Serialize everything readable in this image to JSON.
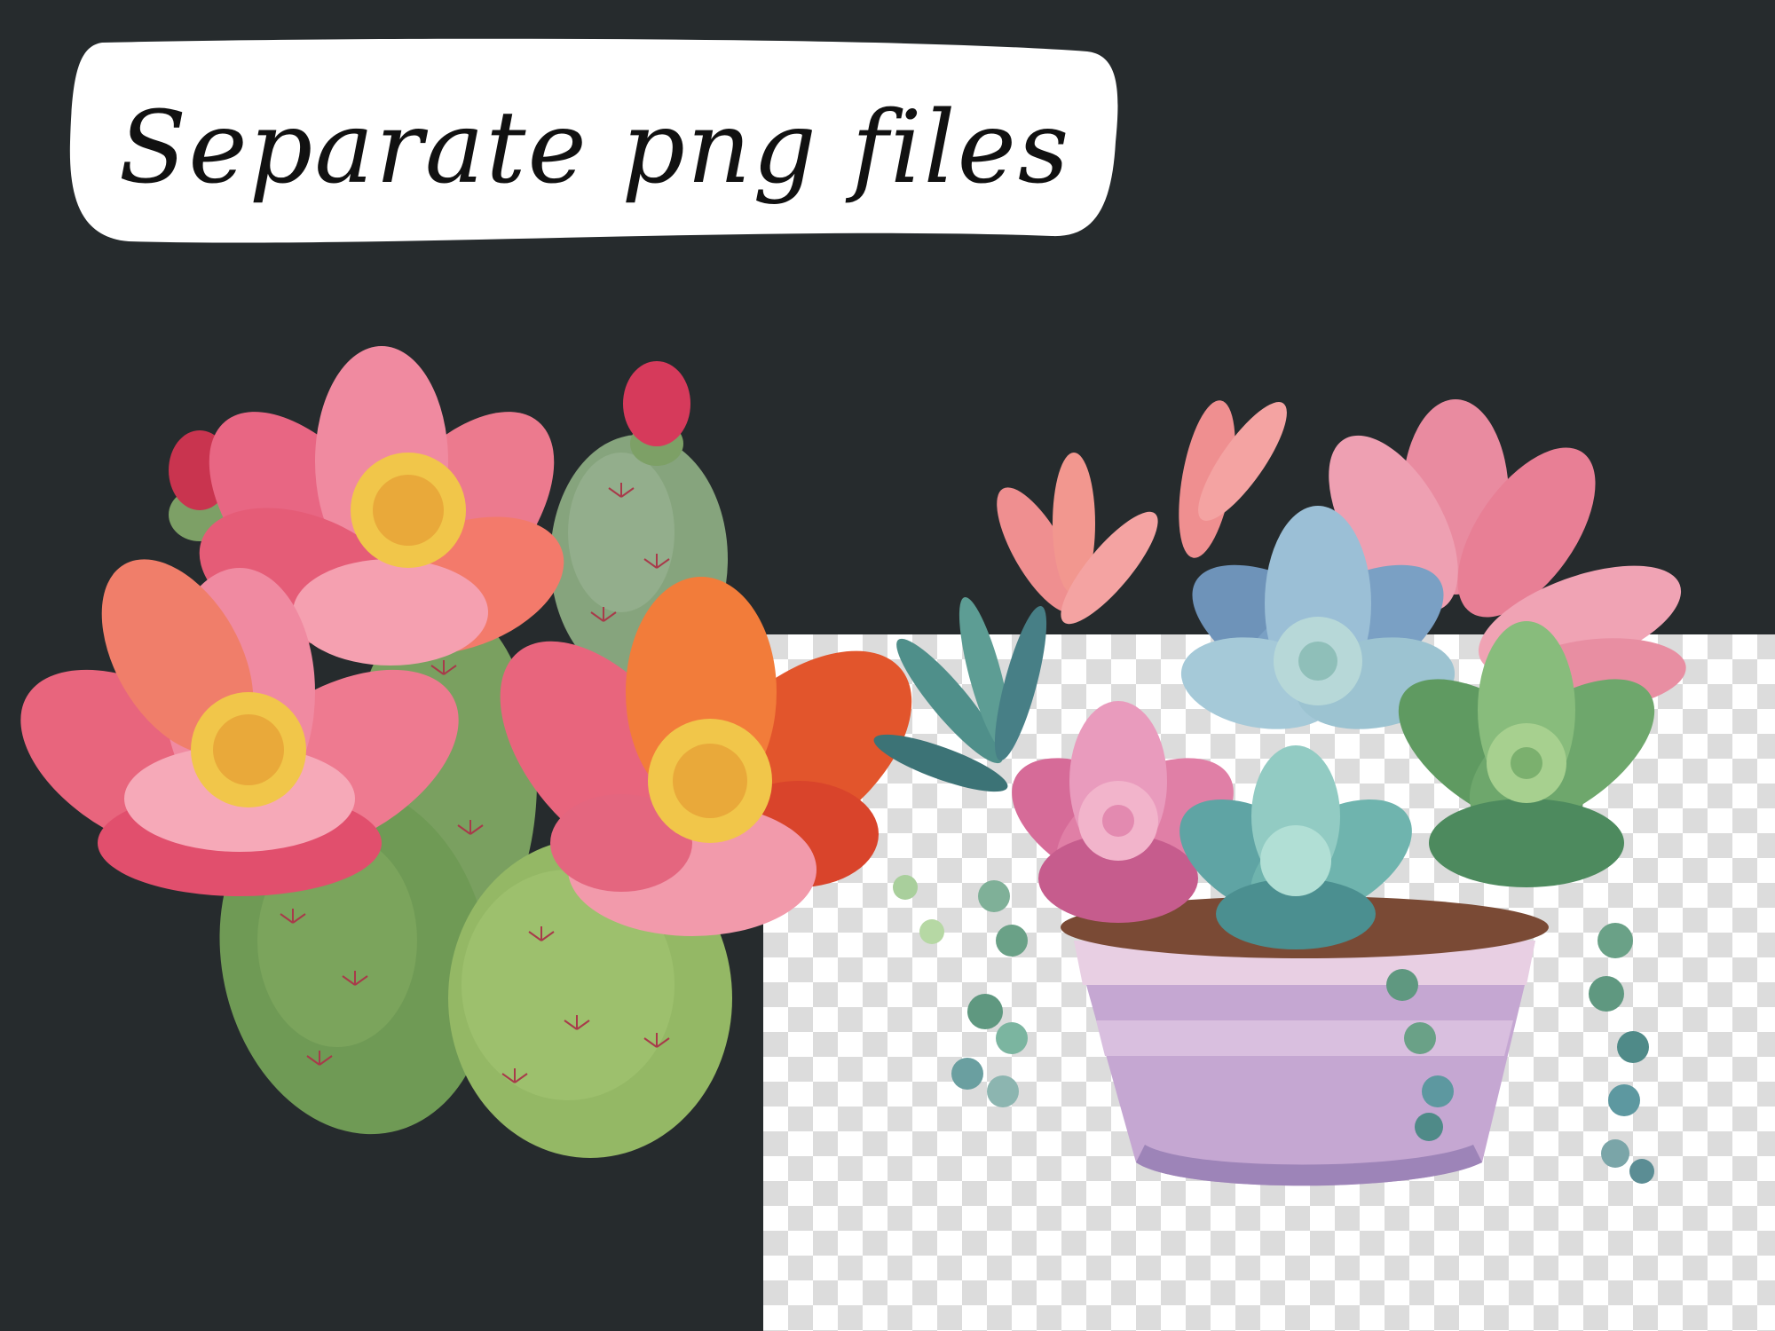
{
  "banner": {
    "text": "Separate png files"
  },
  "images": {
    "cactus": "watercolor-prickly-pear-cactus",
    "succulent": "watercolor-succulent-pot"
  },
  "colors": {
    "background": "#262b2d",
    "banner": "#ffffff",
    "checker_light": "#ffffff",
    "checker_dark": "#dcdcdc"
  }
}
